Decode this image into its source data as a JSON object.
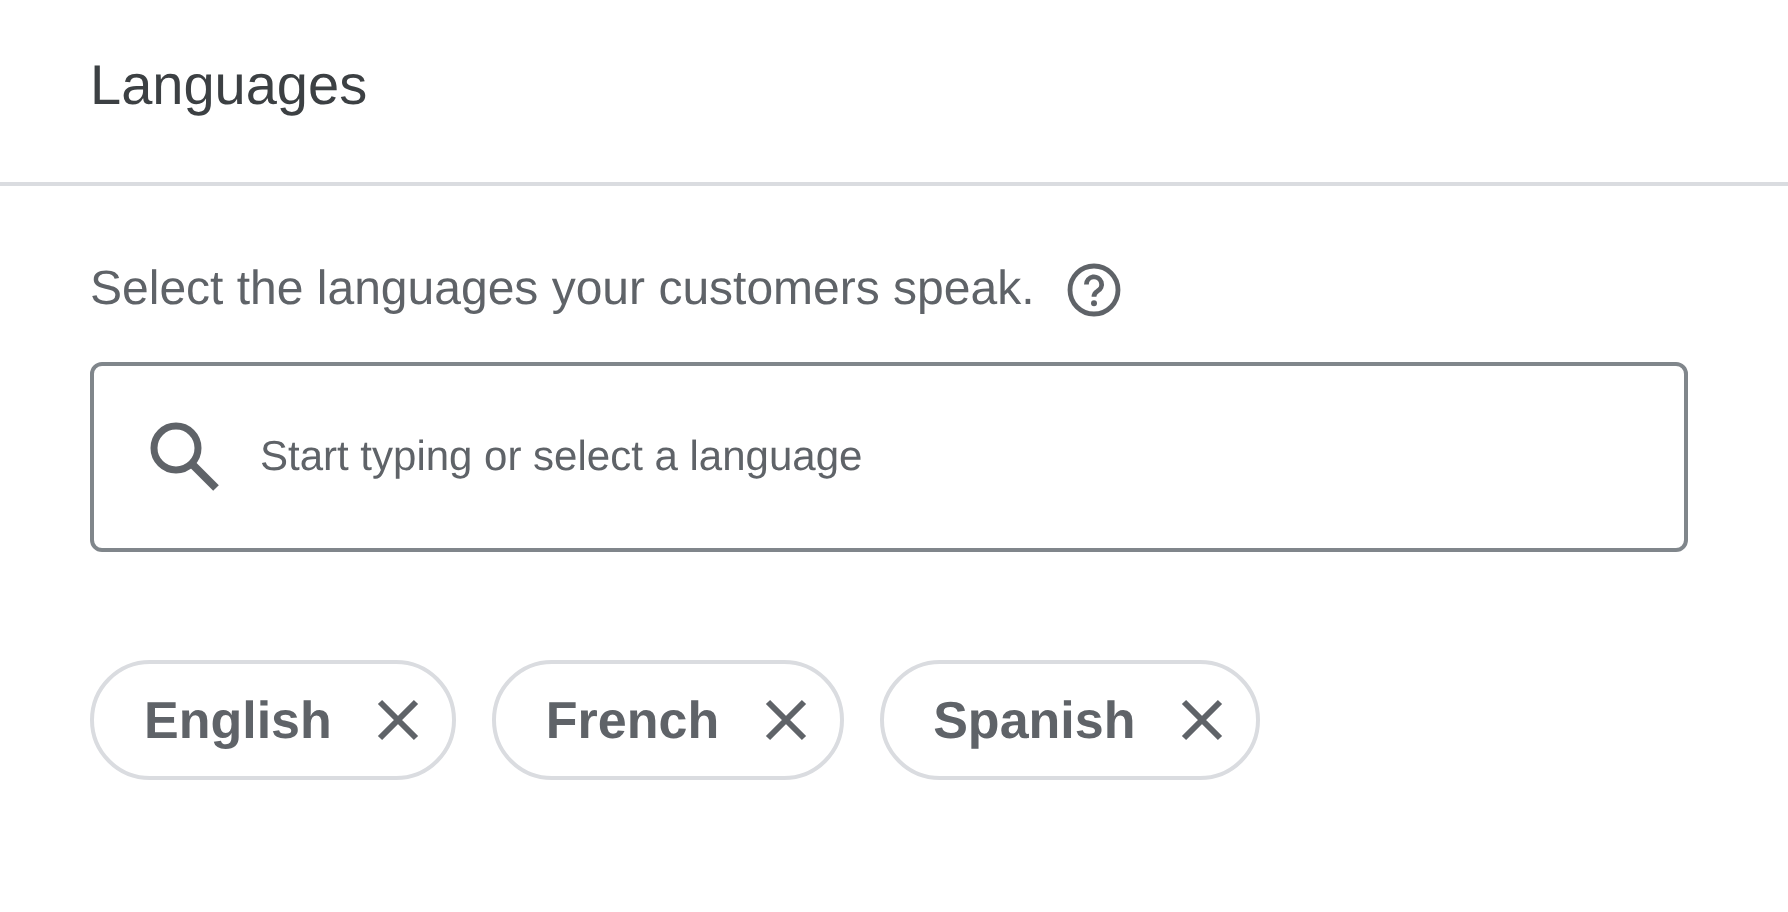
{
  "title": "Languages",
  "description": "Select the languages your customers speak.",
  "search": {
    "placeholder": "Start typing or select a language"
  },
  "chips": [
    {
      "label": "English"
    },
    {
      "label": "French"
    },
    {
      "label": "Spanish"
    }
  ]
}
